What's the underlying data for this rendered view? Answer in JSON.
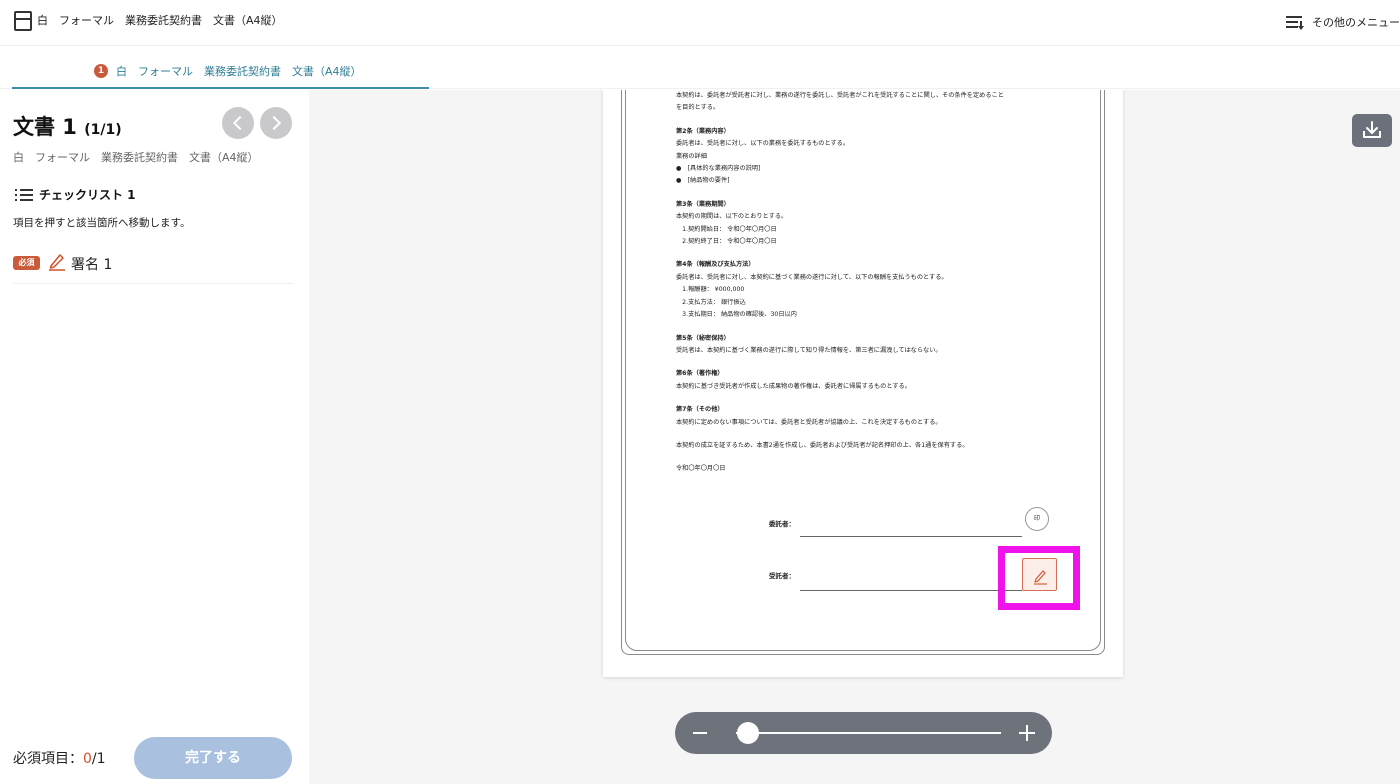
{
  "header": {
    "title": "白　フォーマル　業務委託契約書　文書（A4縦）",
    "menu_label": "その他のメニュー",
    "icons": {
      "document": "document-icon",
      "menu": "menu-sort-icon"
    }
  },
  "tab": {
    "badge": "1",
    "label": "白　フォーマル　業務委託契約書　文書（A4縦）",
    "accent_color": "#3f8ea7"
  },
  "sidebar": {
    "doc_title": "文書 1",
    "doc_page": "(1/1)",
    "doc_subtitle": "白　フォーマル　業務委託契約書　文書（A4縦）",
    "checklist_title": "チェックリスト 1",
    "hint": "項目を押すと該当箇所へ移動します。",
    "items": [
      {
        "badge": "必須",
        "label": "署名 1",
        "icon": "pen-icon"
      }
    ],
    "required_label": "必須項目：",
    "required_done": "0",
    "required_total": "/1",
    "complete_label": "完了する",
    "complete_color": "#a9c0df",
    "badge_color": "#c95a3c"
  },
  "document": {
    "lines": [
      {
        "text": "本契約は、委託者が受託者に対し、業務の遂行を委託し、受託者がこれを受託することに関し、その条件を定めること",
        "bold": false
      },
      {
        "text": "を目的とする。",
        "bold": false
      },
      {
        "text": "",
        "gap": true
      },
      {
        "text": "第2条（業務内容）",
        "bold": true
      },
      {
        "text": "委託者は、受託者に対し、以下の業務を委託するものとする。",
        "bold": false
      },
      {
        "text": "業務の詳細",
        "bold": false
      },
      {
        "text": "●　[具体的な業務内容の説明]",
        "bold": false
      },
      {
        "text": "●　[納品物の要件]",
        "bold": false
      },
      {
        "text": "",
        "gap": true
      },
      {
        "text": "第3条（業務期間）",
        "bold": true
      },
      {
        "text": "本契約の期間は、以下のとおりとする。",
        "bold": false
      },
      {
        "text": "　1.契約開始日： 令和〇年〇月〇日",
        "bold": false
      },
      {
        "text": "　2.契約終了日： 令和〇年〇月〇日",
        "bold": false
      },
      {
        "text": "",
        "gap": true
      },
      {
        "text": "第4条（報酬及び支払方法）",
        "bold": true
      },
      {
        "text": "委託者は、受託者に対し、本契約に基づく業務の遂行に対して、以下の報酬を支払うものとする。",
        "bold": false
      },
      {
        "text": "　1.報酬額： ¥000,000",
        "bold": false
      },
      {
        "text": "　2.支払方法： 銀行振込",
        "bold": false
      },
      {
        "text": "　3.支払期日： 納品物の確認後、30日以内",
        "bold": false
      },
      {
        "text": "",
        "gap": true
      },
      {
        "text": "第5条（秘密保持）",
        "bold": true
      },
      {
        "text": "受託者は、本契約に基づく業務の遂行に際して知り得た情報を、第三者に漏洩してはならない。",
        "bold": false
      },
      {
        "text": "",
        "gap": true
      },
      {
        "text": "第6条（著作権）",
        "bold": true
      },
      {
        "text": "本契約に基づき受託者が作成した成果物の著作権は、委託者に帰属するものとする。",
        "bold": false
      },
      {
        "text": "",
        "gap": true
      },
      {
        "text": "第7条（その他）",
        "bold": true
      },
      {
        "text": "本契約に定めのない事項については、委託者と受託者が協議の上、これを決定するものとする。",
        "bold": false
      },
      {
        "text": "",
        "gap": true
      },
      {
        "text": "本契約の成立を証するため、本書2通を作成し、委託者および受託者が記名押印の上、各1通を保有する。",
        "bold": false
      },
      {
        "text": "",
        "gap": true
      },
      {
        "text": "令和〇年〇月〇日",
        "bold": false
      }
    ],
    "client_label": "委託者：",
    "contractor_label": "受託者：",
    "stamp_label": "印",
    "highlight_color": "#ef12ea"
  },
  "zoom": {
    "level": 0.1
  },
  "icons": {
    "download": "download-icon",
    "prev": "chevron-left-icon",
    "next": "chevron-right-icon"
  }
}
